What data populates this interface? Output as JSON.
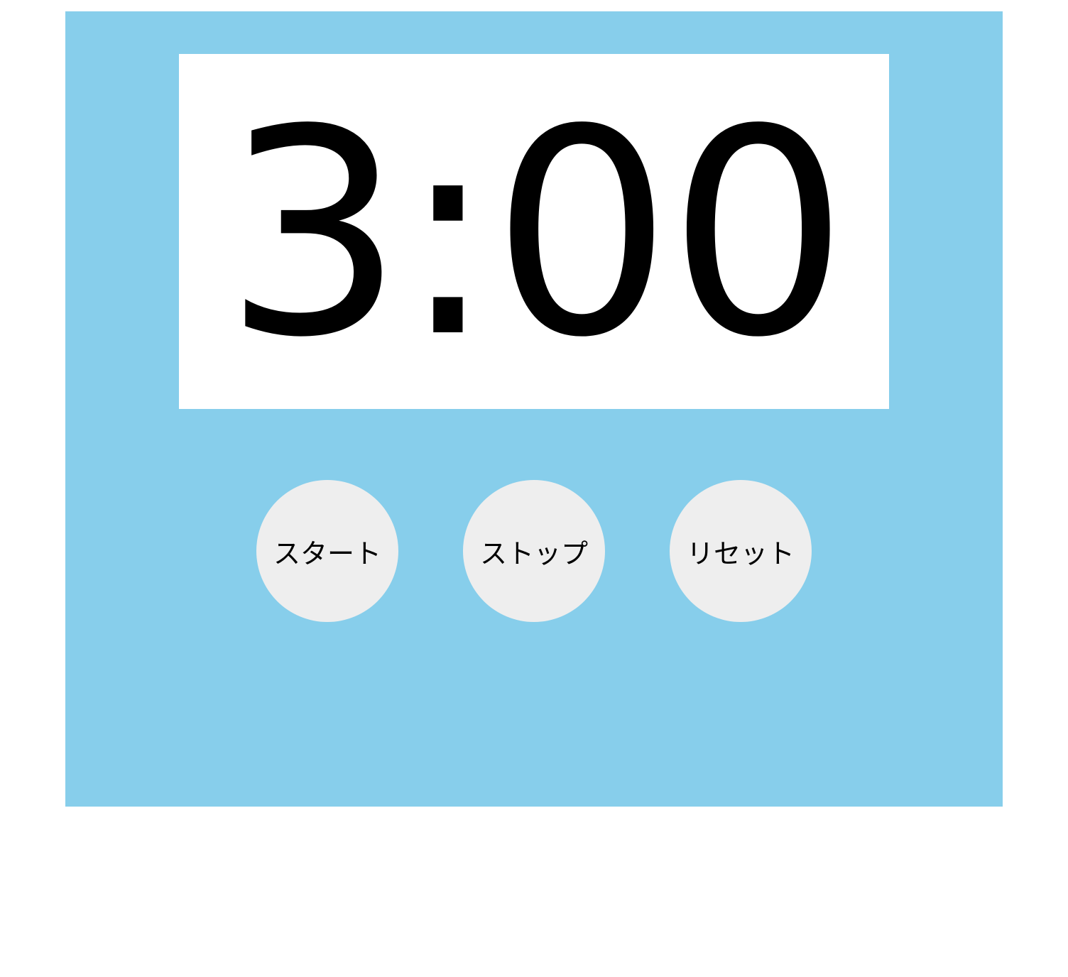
{
  "timer": {
    "display": "3:00"
  },
  "controls": {
    "start_label": "スタート",
    "stop_label": "ストップ",
    "reset_label": "リセット"
  },
  "colors": {
    "panel_background": "#87ceeb",
    "display_background": "#ffffff",
    "button_background": "#eeeeee",
    "text": "#000000"
  }
}
